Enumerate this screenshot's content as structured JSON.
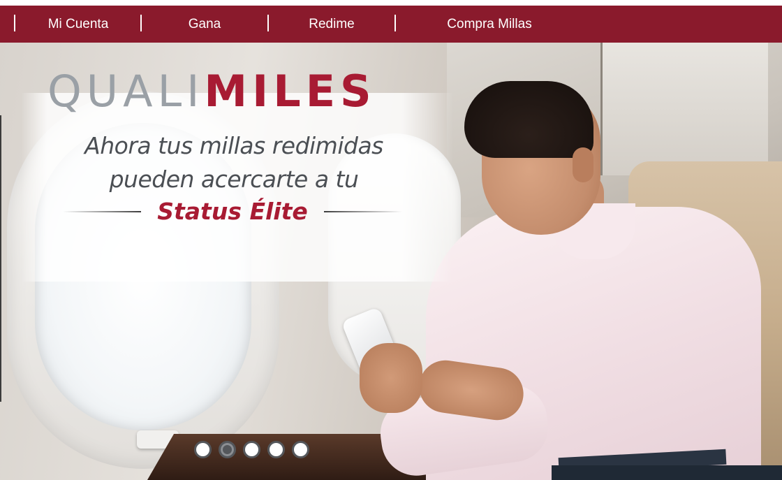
{
  "nav": {
    "items": [
      {
        "label": "Mi Cuenta"
      },
      {
        "label": "Gana"
      },
      {
        "label": "Redime"
      },
      {
        "label": "Compra Millas"
      }
    ],
    "background": "#8a1a2c"
  },
  "hero": {
    "brand_part1": "QUALI",
    "brand_part2": "MILES",
    "tagline_line1": "Ahora tus millas redimidas",
    "tagline_line2": "pueden acercarte a tu",
    "status_text": "Status Élite",
    "brand_color": "#a81b33"
  },
  "carousel": {
    "slide_count": 5,
    "active_index": 1
  }
}
